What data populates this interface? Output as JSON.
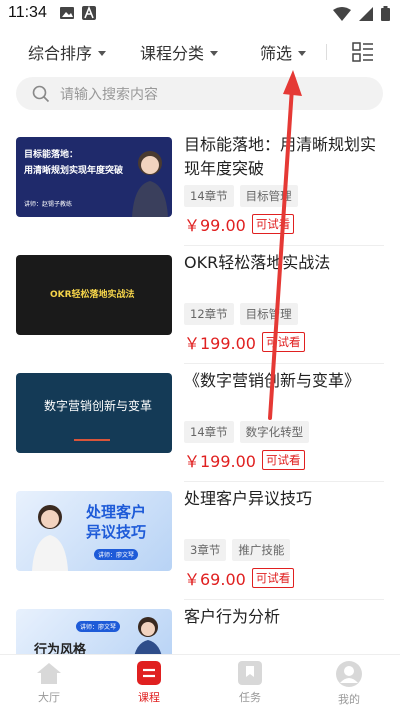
{
  "status": {
    "time": "11:34",
    "left_icons": [
      "image-icon",
      "a-icon"
    ],
    "right_icons": [
      "wifi-icon",
      "signal-icon",
      "battery-icon"
    ]
  },
  "filters": {
    "sort": "综合排序",
    "category": "课程分类",
    "filter": "筛选"
  },
  "search": {
    "placeholder": "请输入搜索内容"
  },
  "courses": [
    {
      "title": "目标能落地：用清晰规划实现年度突破",
      "tags": [
        "14章节",
        "目标管理"
      ],
      "price": "￥99.00",
      "trial": "可试看",
      "thumb": {
        "line1": "目标能落地：",
        "line2": "用清晰规划实现年度突破",
        "lecturer": "讲师：赵锡子教练",
        "bg": "#1f2a6b"
      }
    },
    {
      "title": "OKR轻松落地实战法",
      "tags": [
        "12章节",
        "目标管理"
      ],
      "price": "￥199.00",
      "trial": "可试看",
      "thumb": {
        "line1": "OKR轻松落地实战法",
        "bg": "#1a1a1a"
      }
    },
    {
      "title": "《数字营销创新与变革》",
      "tags": [
        "14章节",
        "数字化转型"
      ],
      "price": "￥199.00",
      "trial": "可试看",
      "thumb": {
        "line1": "数字营销创新与变革",
        "bg": "#143a56"
      }
    },
    {
      "title": "处理客户异议技巧",
      "tags": [
        "3章节",
        "推广技能"
      ],
      "price": "￥69.00",
      "trial": "可试看",
      "thumb": {
        "line1": "处理客户",
        "line2": "异议技巧",
        "lecturer": "讲师：廖文琴",
        "bg": "#d9e8fb"
      }
    },
    {
      "title": "客户行为分析",
      "thumb": {
        "line1": "行为风格",
        "lecturer": "讲师：廖文琴",
        "bg": "#d9e8fb"
      }
    }
  ],
  "nav": [
    {
      "label": "大厅",
      "icon": "home-icon"
    },
    {
      "label": "课程",
      "icon": "course-icon",
      "active": true
    },
    {
      "label": "任务",
      "icon": "bookmark-icon"
    },
    {
      "label": "我的",
      "icon": "profile-icon"
    }
  ],
  "colors": {
    "accent": "#e02020",
    "annotation": "#e53935"
  }
}
